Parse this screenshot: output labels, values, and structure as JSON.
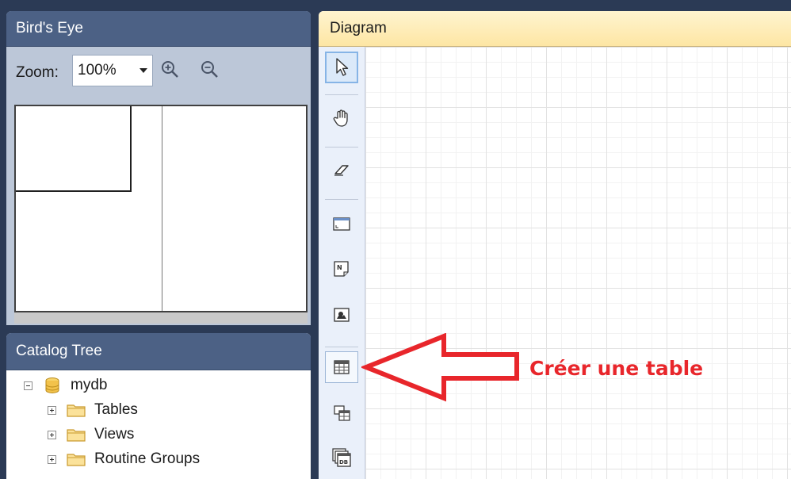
{
  "birds_eye": {
    "title": "Bird's Eye",
    "zoom_label": "Zoom:",
    "zoom_value": "100%",
    "zoom_in_icon": "zoom-in-icon",
    "zoom_out_icon": "zoom-out-icon"
  },
  "catalog": {
    "title": "Catalog Tree",
    "items": [
      {
        "label": "mydb",
        "icon": "database-icon",
        "expander": "minus"
      },
      {
        "label": "Tables",
        "icon": "folder-icon",
        "expander": "plus"
      },
      {
        "label": "Views",
        "icon": "folder-icon",
        "expander": "plus"
      },
      {
        "label": "Routine Groups",
        "icon": "folder-icon",
        "expander": "plus"
      }
    ]
  },
  "diagram": {
    "title": "Diagram",
    "tools": [
      {
        "name": "select-tool",
        "icon": "pointer-icon"
      },
      {
        "name": "hand-tool",
        "icon": "hand-icon"
      },
      {
        "name": "eraser-tool",
        "icon": "eraser-icon"
      },
      {
        "name": "layer-tool",
        "icon": "layer-icon"
      },
      {
        "name": "note-tool",
        "icon": "note-icon"
      },
      {
        "name": "image-tool",
        "icon": "image-icon"
      },
      {
        "name": "table-tool",
        "icon": "table-icon"
      },
      {
        "name": "view-tool",
        "icon": "view-icon"
      },
      {
        "name": "routine-group-tool",
        "icon": "routine-group-icon"
      }
    ]
  },
  "annotation": {
    "text": "Créer une table",
    "color": "#e8262b"
  },
  "colors": {
    "panel_header": "#4c6185",
    "diagram_header": "#fde6a4",
    "accent": "#e8262b"
  }
}
